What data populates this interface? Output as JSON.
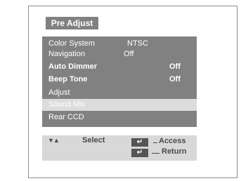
{
  "menu_title": "Pre Adjust",
  "items": [
    {
      "label": "Color System",
      "value": "NTSC",
      "bold": false
    },
    {
      "label": "Navigation",
      "value": "Off",
      "bold": false
    },
    {
      "label": "Auto Dimmer",
      "value": "Off",
      "bold": true
    },
    {
      "label": "Beep Tone",
      "value": "Off",
      "bold": true
    },
    {
      "label": "Adjust",
      "value": "",
      "bold": false
    },
    {
      "label": "Sound Mix",
      "value": "",
      "bold": false,
      "selected": true
    },
    {
      "label": "Rear CCD",
      "value": "",
      "bold": false
    }
  ],
  "footer": {
    "updown_symbol": "▼▲",
    "select_label": "Select",
    "enter_symbol": "↵",
    "access_label": "Access",
    "return_label": "Return"
  },
  "colors": {
    "menu_bg": "#818181",
    "selected_bg": "#dcdcdc",
    "footer_bg": "#d8d8d8",
    "footer_text": "#4a4a4a"
  }
}
